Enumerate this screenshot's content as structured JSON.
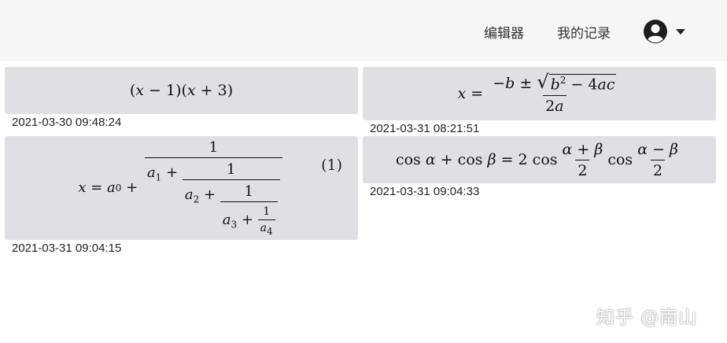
{
  "nav": {
    "editor_label": "编辑器",
    "records_label": "我的记录"
  },
  "formulas": [
    {
      "timestamp": "2021-03-30 09:48:24"
    },
    {
      "timestamp": "2021-03-31 08:21:51"
    },
    {
      "timestamp": "2021-03-31 09:04:15",
      "equation_number": "(1)"
    },
    {
      "timestamp": "2021-03-31 09:04:33"
    }
  ],
  "watermark": "知乎 @南山",
  "colors": {
    "topbar": "#f6f6f6",
    "card": "#dee0e4"
  },
  "icons": {
    "avatar": "user-circle-icon",
    "caret": "caret-down-icon"
  }
}
